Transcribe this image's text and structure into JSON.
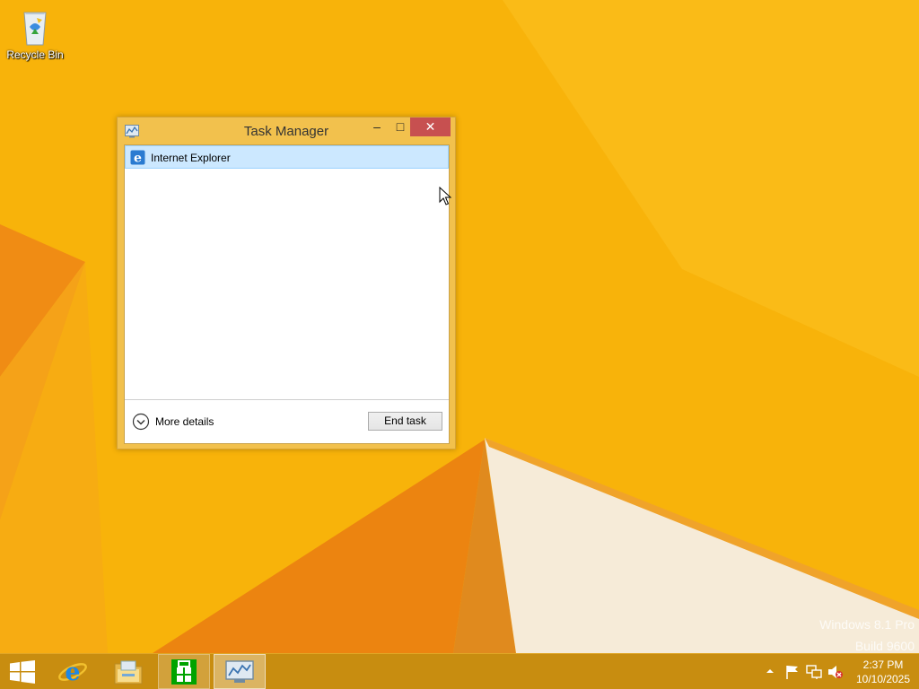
{
  "desktop": {
    "icons": [
      {
        "label": "Recycle Bin",
        "icon": "recycle-bin-icon"
      }
    ],
    "watermark": {
      "line1": "Windows 8.1 Pro",
      "line2": "Build 9600"
    }
  },
  "task_manager": {
    "title": "Task Manager",
    "controls": {
      "minimize": "–",
      "maximize": "□",
      "close": "✕"
    },
    "processes": [
      {
        "name": "Internet Explorer",
        "icon": "internet-explorer-icon",
        "selected": true
      }
    ],
    "more_details_label": "More details",
    "end_task_label": "End task"
  },
  "taskbar": {
    "pinned": [
      {
        "name": "start",
        "icon": "windows-logo-icon"
      },
      {
        "name": "internet-explorer",
        "icon": "internet-explorer-icon"
      },
      {
        "name": "file-explorer",
        "icon": "folder-icon"
      },
      {
        "name": "store",
        "icon": "store-icon"
      },
      {
        "name": "task-manager",
        "icon": "task-manager-icon",
        "active": true
      }
    ],
    "tray": {
      "icons": [
        "show-hidden-icons-icon",
        "action-center-flag-icon",
        "network-icon",
        "volume-muted-icon"
      ],
      "time": "2:37 PM",
      "date": "10/10/2025"
    }
  },
  "colors": {
    "wallpaper": "#f8b30a",
    "window_frame": "#f2c14d",
    "close_button": "#c75050",
    "selection": "#cce8ff",
    "taskbar": "#c88d10"
  }
}
